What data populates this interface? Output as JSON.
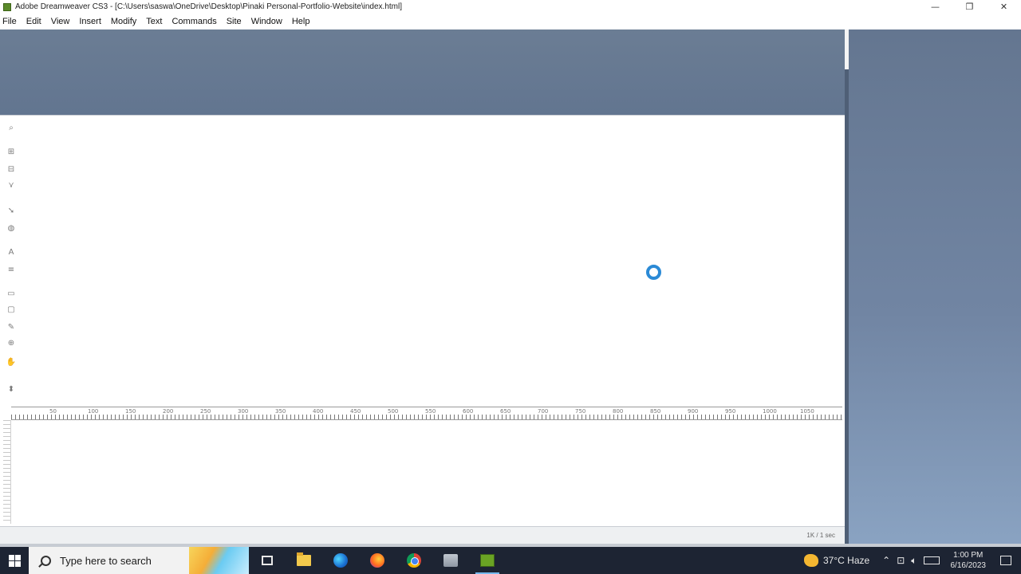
{
  "window": {
    "title": "Adobe Dreamweaver CS3 - [C:\\Users\\saswa\\OneDrive\\Desktop\\Pinaki Personal-Portfolio-Website\\index.html]",
    "minimize_glyph": "—",
    "restore_glyph": "❐",
    "close_glyph": "✕"
  },
  "menu": {
    "items": [
      "File",
      "Edit",
      "View",
      "Insert",
      "Modify",
      "Text",
      "Commands",
      "Site",
      "Window",
      "Help"
    ]
  },
  "ruler": {
    "labels": [
      "50",
      "100",
      "150",
      "200",
      "250",
      "300",
      "350",
      "400",
      "450",
      "500",
      "550",
      "600",
      "650",
      "700",
      "750",
      "800",
      "850",
      "900",
      "950",
      "1000",
      "1050"
    ]
  },
  "status": {
    "download": "1K / 1 sec"
  },
  "taskbar": {
    "search_placeholder": "Type here to search",
    "weather": "37°C  Haze",
    "time": "1:00 PM",
    "date": "6/16/2023",
    "icons": [
      "task-view-icon",
      "file-explorer-icon",
      "edge-icon",
      "firefox-icon",
      "chrome-icon",
      "app-icon",
      "dreamweaver-icon"
    ]
  },
  "colors": {
    "workspace": "#627590",
    "taskbar": "#1d2433",
    "busy_cursor": "#2b8ad6"
  }
}
